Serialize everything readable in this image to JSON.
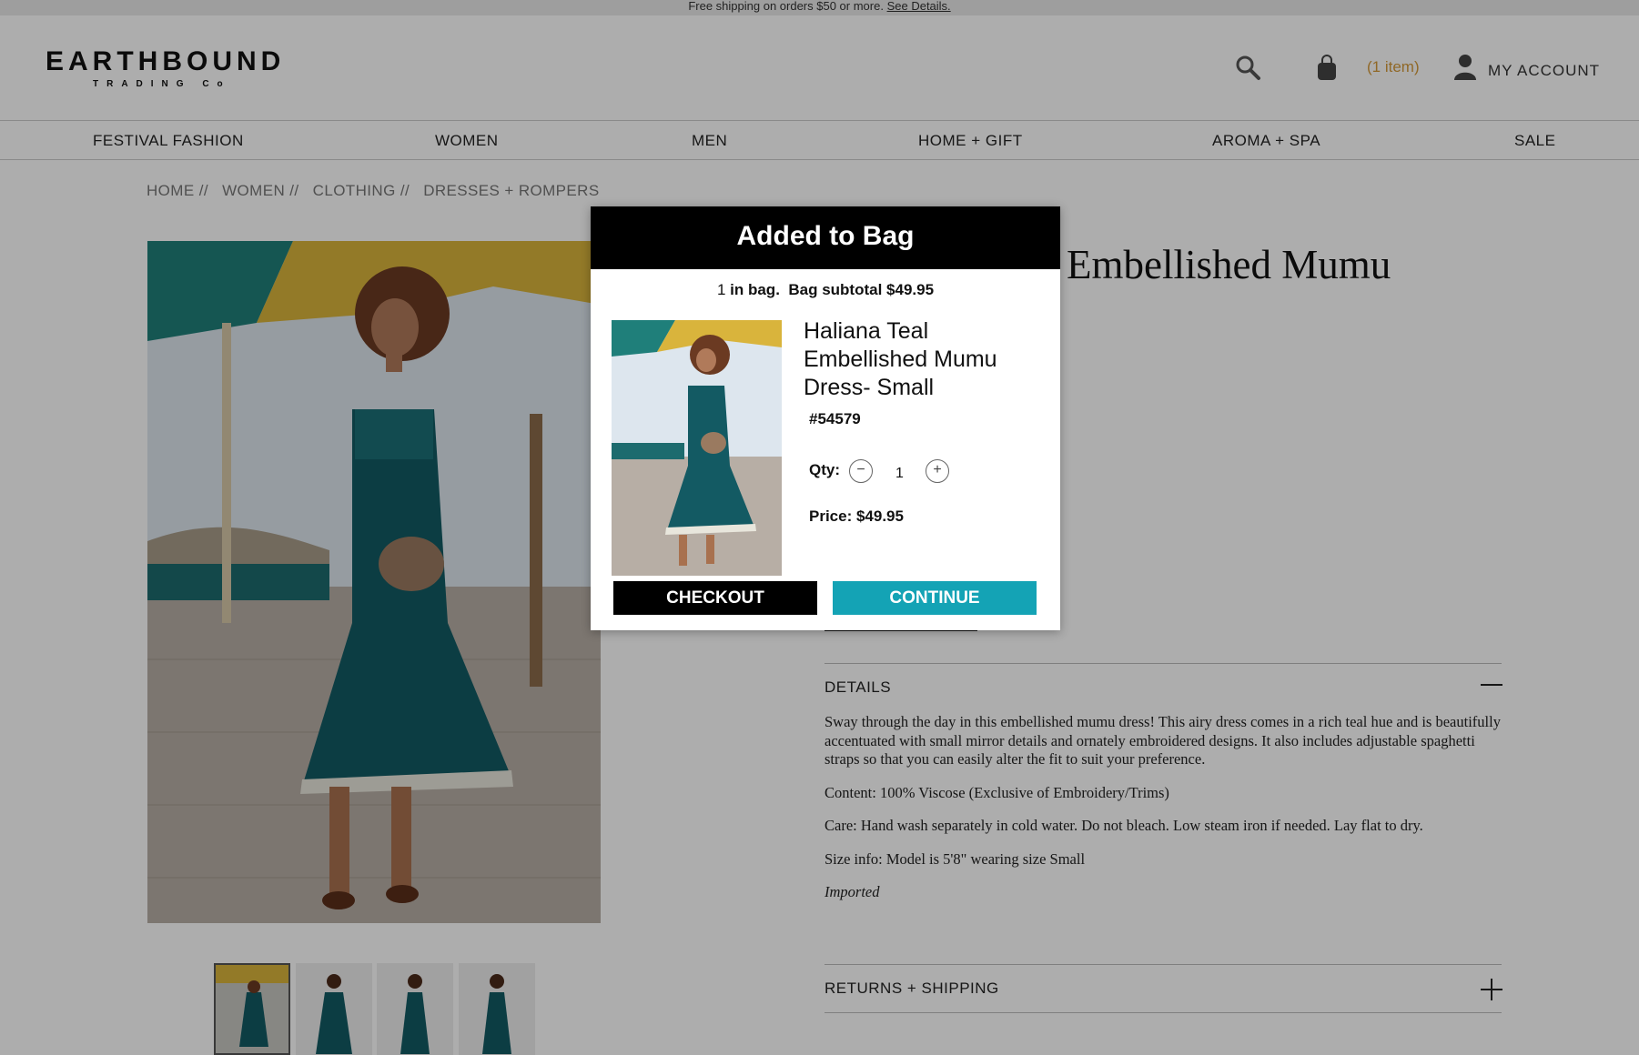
{
  "promo": {
    "text": "Free shipping on orders $50 or more.",
    "link": "See Details."
  },
  "header": {
    "logo_main": "EARTHBOUND",
    "logo_sub": "TRADING Co",
    "bag_count": "(1 item)",
    "account": "MY ACCOUNT",
    "icons": [
      "search-icon",
      "bag-icon",
      "account-icon"
    ]
  },
  "nav": [
    "FESTIVAL FASHION",
    "WOMEN",
    "MEN",
    "HOME + GIFT",
    "AROMA + SPA",
    "SALE"
  ],
  "breadcrumb": [
    "HOME //",
    "WOMEN //",
    "CLOTHING //",
    "DRESSES + ROMPERS"
  ],
  "product": {
    "title": "Embellished Mumu",
    "accordions": {
      "details": "DETAILS",
      "returns": "RETURNS + SHIPPING"
    },
    "details": [
      "Sway through the day in this embellished mumu dress! This airy dress comes in a rich teal hue and is beautifully accentuated with small mirror details and ornately embroidered designs. It also includes adjustable spaghetti straps so that you can easily alter the fit to suit your preference.",
      "Content: 100% Viscose (Exclusive of Embroidery/Trims)",
      "Care: Hand wash separately in cold water. Do not bleach. Low steam iron if needed. Lay flat to dry.",
      "Size info: Model is 5'8\" wearing size Small",
      "Imported"
    ]
  },
  "modal": {
    "title": "Added to Bag",
    "in_bag_count": "1",
    "in_bag_text": "in bag.",
    "subtotal": "Bag subtotal $49.95",
    "item_name": "Haliana Teal Embellished Mumu Dress- Small",
    "sku": "#54579",
    "qty_label": "Qty:",
    "qty_minus": "−",
    "qty_value": "1",
    "qty_plus": "+",
    "price": "Price: $49.95",
    "checkout": "CHECKOUT",
    "continue": "CONTINUE"
  },
  "colors": {
    "accent": "#14a3b5",
    "bag_count": "#d49a3a",
    "dress": "#135a63"
  }
}
